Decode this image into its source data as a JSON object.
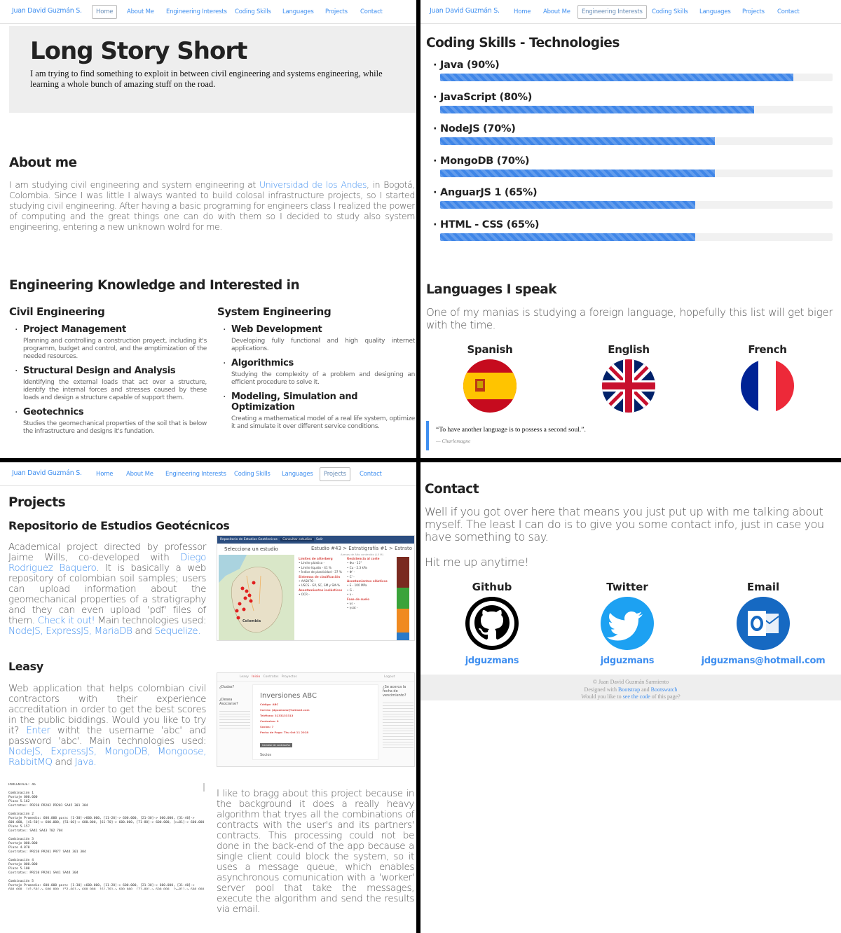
{
  "nav": {
    "brand": "Juan David Guzmán S.",
    "items": [
      "Home",
      "About Me",
      "Engineering Interests",
      "Coding Skills",
      "Languages",
      "Projects",
      "Contact"
    ]
  },
  "hero": {
    "title": "Long Story Short",
    "subtitle": "I am trying to find something to exploit in between civil engineering and systems engineering, while learning a whole bunch of amazing stuff on the road."
  },
  "about": {
    "title": "About me",
    "text_before": "I am studying civil engineering and system engineering at ",
    "link": "Universidad de los Andes",
    "text_after": ", in Bogotá, Colombia. Since I was little I always wanted to build colosal infrastructure projects, so I started studying civil engineering. After having a basic programing for engineers class I realized the power of computing and the great things one can do with them so I decided to study also system engineering, entering a new unknown wolrd for me."
  },
  "engineering": {
    "title": "Engineering Knowledge and Interested in",
    "civil": {
      "title": "Civil Engineering",
      "items": [
        {
          "title": "Project Management",
          "desc": "Planning and controlling a construction proyect, including it's programm, budget and control, and the ømptimization of the needed resources."
        },
        {
          "title": "Structural Design and Analysis",
          "desc": "Identifying the external loads that act over a structure, identify the internal forces and stresses caused by these loads and design a structure capable of support them."
        },
        {
          "title": "Geotechnics",
          "desc": "Studies the geomechanical properties of the soil that is below the infrastructure and designs it's fundation."
        }
      ]
    },
    "system": {
      "title": "System Engineering",
      "items": [
        {
          "title": "Web Development",
          "desc": "Developing fully functional and high quality internet applications."
        },
        {
          "title": "Algorithmics",
          "desc": "Studying the complexity of a problem and designing an efficient procedure to solve it."
        },
        {
          "title": "Modeling, Simulation and Optimization",
          "desc": "Creating a mathematical model of a real life system, optimize it and simulate it over different service conditions."
        }
      ]
    }
  },
  "skills": {
    "title": "Coding Skills - Technologies",
    "items": [
      {
        "label": "Java (90%)",
        "level": 0.9
      },
      {
        "label": "JavaScript (80%)",
        "level": 0.8
      },
      {
        "label": "NodeJS (70%)",
        "level": 0.7
      },
      {
        "label": "MongoDB (70%)",
        "level": 0.7
      },
      {
        "label": "AnguarJS 1 (65%)",
        "level": 0.65
      },
      {
        "label": "HTML - CSS (65%)",
        "level": 0.65
      }
    ]
  },
  "languages": {
    "title": "Languages I speak",
    "intro": "One of my manias is studying a foreign language, hopefully this list will get biger with the time.",
    "items": [
      "Spanish",
      "English",
      "French"
    ],
    "quote": "“To have another language is to possess a second soul.”.",
    "quote_author": "— Charlemagne"
  },
  "projects": {
    "title": "Projects",
    "p1": {
      "title": "Repositorio de Estudios Geotécnicos",
      "t1": "Academical project directed by professor Jaime Wills, co-developed with ",
      "link1": "Diego Rodriguez Baquero",
      "t2": ". It is basically a web repository of colombian soil samples; users can upload information about the geomechanical properties of a stratigraphy and they can even upload 'pdf' files of them. ",
      "link2": "Check it out!",
      "t3": " Main technologies used: ",
      "tech": [
        "NodeJS,",
        "ExpressJS,",
        "MariaDB",
        "Sequelize."
      ],
      "and": "and",
      "shot": {
        "topbar": [
          "Repositorio de Estudios Geotécnicos",
          "Consultar estudios",
          "Salir"
        ],
        "select": "Selecciona un estudio",
        "header": "Estudio #43 > Estratigrafía #1 > Estrato #5",
        "sub": "Arenas de Alto contenido (L5 M)",
        "col1": [
          "Límites de atterberg",
          "• Límite plástico -",
          "• Límite líquido - 41 %",
          "• Índice de plasticidad - 37 %",
          "Sistemas de clasificación",
          "• AASHTO -",
          "• USCS - GP, SC, SM y SM-% ",
          "Asentamientos inelásticos",
          "• OCR -"
        ],
        "col2": [
          "Resistencia al corte",
          "• Φu - 11°",
          "• Cu - 2.3 kPa",
          "• Φ' -",
          "• C' -",
          "Asentamientos elásticos",
          "• E - 100 MPa",
          "• G -",
          "• ν -",
          "Fase de suelo",
          "• γs -",
          "• γsat -"
        ],
        "map_label": "Colombia"
      }
    },
    "p2": {
      "title": "Leasy",
      "t1": "Web application that helps colombian civil contractors with their experience accreditation in order to get the best scores in the public biddings. Would you like to try it? ",
      "link1": "Enter",
      "t2": " witht the username 'abc' and password 'abc'. Main technologies used: ",
      "tech": [
        "NodeJS,",
        "ExpressJS,",
        "MongoDB,",
        "Mongoose,",
        "RabbitMQ",
        "Java."
      ],
      "and": "and",
      "shot": {
        "nav": [
          "Leasy",
          "Inicio",
          "Contratos",
          "Proyectos",
          "Logout"
        ],
        "left_title": "¿Dudas?",
        "left2": "¿Desea Asociarse?",
        "company": "Inversiones ABC",
        "fields": [
          "Código: ABC",
          "Correo: jdguzmans@hotmail.com",
          "Teléfono: 3133133313",
          "Contratos: 0",
          "Socios: 7",
          "Fecha de Pago: Thu Oct 11 2018"
        ],
        "button": "Cambiar de contraseña",
        "socios": "Socios",
        "right_title": "¿Se acerca la fecha de vencimiento?"
      },
      "brag": "I like to bragg about this project because in the background it does a really heavy algorithm that tryes all the combinations of contracts with the user's and its partners' contracts. This processing could not be done in the back-end of the app because a single client could block the system, so it uses a message queue, which enables asynchronous comunication with a 'worker' server pool that take the messages, execute the algorithm and send the results via email.",
      "console": "PORCENTAJE: 46\n\nCombinación 1\nPuntaje 000.000\nPlazo 5.162\nContratos: PR210 PR202 PR201 SA45 301 304\n\nCombinación 2\nPuntaje Promedio: 600.000 para: [1-30]->600.000, [11-20]-> 600.000, [21-30]-> 600.000, [31-40]->\n600.000, [41-50]-> 600.000, [51-60]-> 600.000, [61-70]-> 600.000, [71-80]-> 600.000, [>=81]-> 600.000\nPlazo 5.157\nContratos: SA41 SA43 702 704\n\nCombinación 3\nPuntaje 000.000\nPlazo 4.870\nContratos: PR210 PR201 PR77 SA44 301 304\n\nCombinación 4\nPuntaje 000.000\nPlazo 5.100\nContratos: PR210 PR201 SA41 SA44 304\n\nCombinación 5\nPuntaje Promedio: 600.000 para: [1-30]->600.000, [11-20]-> 600.000, [21-30]-> 600.000, [31-40]->\n600.000, [41-50]-> 600.000, [51-60]-> 600.000, [61-70]-> 600.000, [71-80]-> 600.000, [>=81]-> 600.000\nPlazo 4.867"
    }
  },
  "contact": {
    "title": "Contact",
    "intro": "Well if you got over here that means you just put up with me talking about myself. The least I can do is to give you some contact info, just in case you have something to say.",
    "hit": "Hit me up anytime!",
    "items": [
      {
        "name": "Github",
        "handle": "jdguzmans",
        "icon": "github-icon"
      },
      {
        "name": "Twitter",
        "handle": "jdguzmans",
        "icon": "twitter-icon"
      },
      {
        "name": "Email",
        "handle": "jdguzmans@hotmail.com",
        "icon": "outlook-icon"
      }
    ]
  },
  "footer": {
    "line1": "© Juan David Guzmán Sarmiento",
    "designed": "Designed with",
    "bootstrap": "Bootstrap",
    "and": "and",
    "bootswatch": "Bootswatch",
    "like_q": "Would you like to",
    "see_code": "see the code",
    "of_page": "of this page?"
  },
  "colors": {
    "accent": "#3f8ff0",
    "bar": "#3f86e8",
    "hero_bg": "#eeeeee"
  }
}
